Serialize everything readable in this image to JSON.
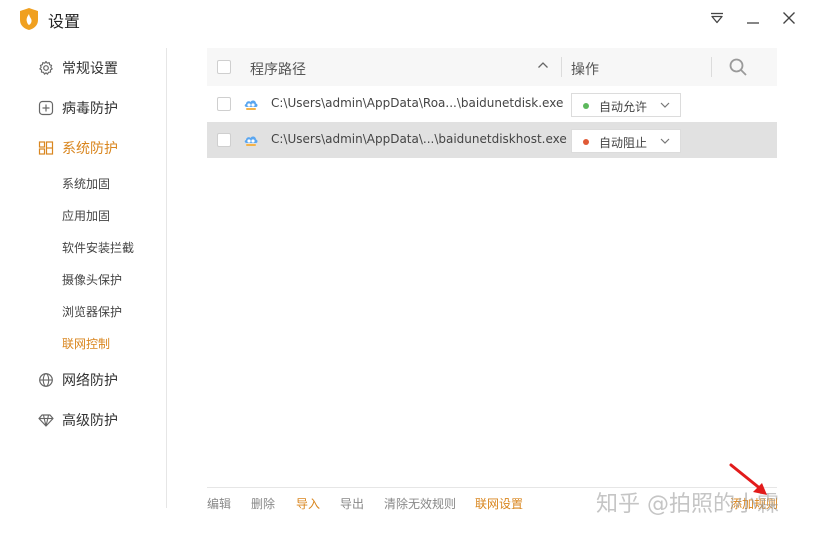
{
  "window": {
    "title": "设置"
  },
  "sidebar": {
    "items": [
      {
        "label": "常规设置",
        "icon": "gear-icon"
      },
      {
        "label": "病毒防护",
        "icon": "plus-square-icon"
      },
      {
        "label": "系统防护",
        "icon": "grid-icon"
      },
      {
        "label": "网络防护",
        "icon": "globe-icon"
      },
      {
        "label": "高级防护",
        "icon": "diamond-icon"
      }
    ],
    "sub_items": [
      "系统加固",
      "应用加固",
      "软件安装拦截",
      "摄像头保护",
      "浏览器保护",
      "联网控制"
    ]
  },
  "table": {
    "header": {
      "path": "程序路径",
      "action": "操作"
    },
    "rows": [
      {
        "path": "C:\\Users\\admin\\AppData\\Roa...\\baidunetdisk.exe",
        "action": "自动允许",
        "status_color": "#5cb85c"
      },
      {
        "path": "C:\\Users\\admin\\AppData\\...\\baidunetdiskhost.exe",
        "action": "自动阻止",
        "status_color": "#e05a36"
      }
    ]
  },
  "footer": {
    "edit": "编辑",
    "delete": "删除",
    "import": "导入",
    "export": "导出",
    "clear": "清除无效规则",
    "network_settings": "联网设置",
    "add_rule": "添加规则"
  },
  "watermark": "知乎 @拍照的小霖",
  "colors": {
    "accent": "#d9861f",
    "logo": "#f0a020"
  }
}
